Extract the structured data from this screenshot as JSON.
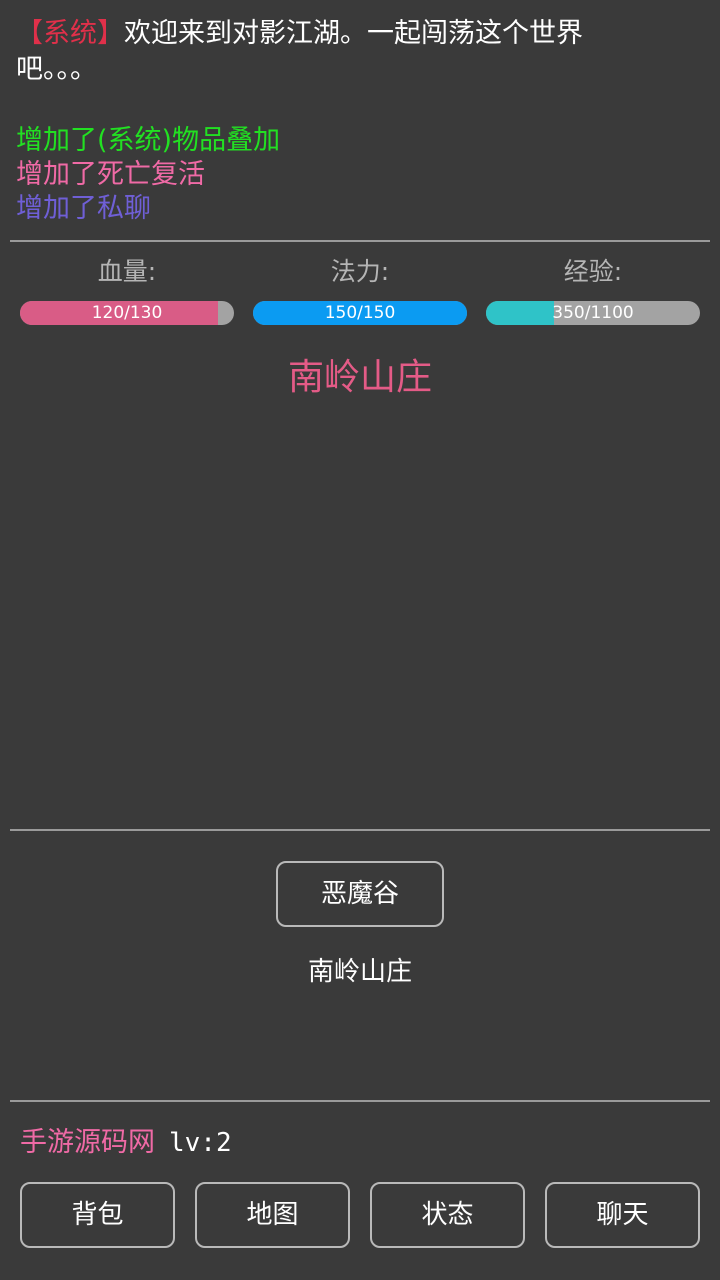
{
  "log": {
    "system_tag": "【系统】",
    "system_message": "欢迎来到对影江湖。一起闯荡这个世界吧。。。",
    "events": [
      {
        "text": "增加了(系统)物品叠加",
        "color": "#22e022"
      },
      {
        "text": "增加了死亡复活",
        "color": "#f06aa6"
      },
      {
        "text": "增加了私聊",
        "color": "#6f5fd6"
      }
    ]
  },
  "stats": {
    "hp": {
      "label": "血量:",
      "current": 120,
      "max": 130,
      "text": "120/130",
      "color": "#d95c86"
    },
    "mp": {
      "label": "法力:",
      "current": 150,
      "max": 150,
      "text": "150/150",
      "color": "#0b9bf2"
    },
    "exp": {
      "label": "经验:",
      "current": 350,
      "max": 1100,
      "text": "350/1100",
      "color": "#2fc3c8"
    }
  },
  "location": {
    "title": "南岭山庄",
    "exit_label": "恶魔谷",
    "current": "南岭山庄"
  },
  "player": {
    "name": "手游源码网",
    "level": "lv:2"
  },
  "nav": {
    "bag": "背包",
    "map": "地图",
    "status": "状态",
    "chat": "聊天"
  },
  "colors": {
    "background": "#3a3a3a",
    "divider": "#9a9a9a",
    "button_border": "#b9b9b9",
    "bar_track": "#a3a3a3"
  }
}
